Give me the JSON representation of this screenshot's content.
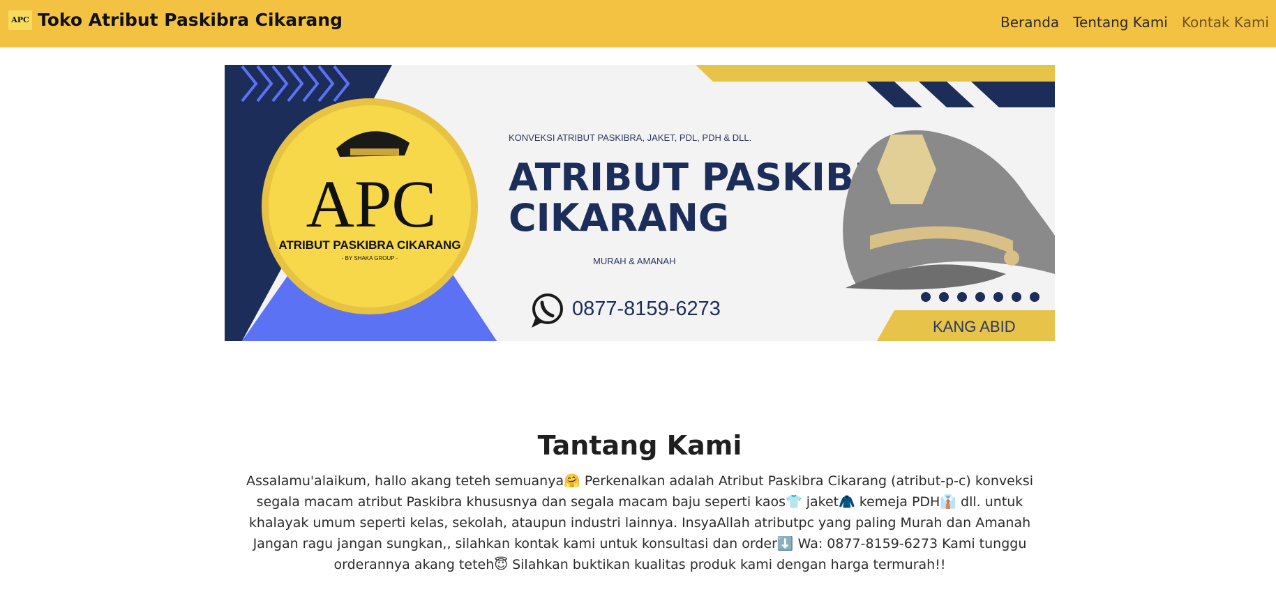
{
  "navbar": {
    "logo_text": "APC",
    "brand_title": "Toko Atribut Paskibra Cikarang",
    "links": [
      "Beranda",
      "Tentang Kami",
      "Kontak Kami"
    ]
  },
  "banner": {
    "logo_letters": "APC",
    "logo_caption": "ATRIBUT PASKIBRA CIKARANG",
    "logo_sub": "- BY SHAKA GROUP -",
    "tagline": "KONVEKSI ATRIBUT PASKIBRA, JAKET, PDL, PDH & DLL.",
    "headline_1": "ATRIBUT PASKIBRA",
    "headline_2": "CIKARANG",
    "motto": "MURAH & AMANAH",
    "phone": "0877-8159-6273",
    "owner": "KANG ABID",
    "colors": {
      "navy": "#1c2d5a",
      "yellow": "#f5d649",
      "blue": "#5c72f5",
      "gold": "#e7c34a"
    }
  },
  "about": {
    "title": "Tantang Kami",
    "body": "Assalamu'alaikum, hallo akang teteh semuanya🤗 Perkenalkan adalah Atribut Paskibra Cikarang (atribut-p-c) konveksi segala macam atribut Paskibra khususnya dan segala macam baju seperti kaos👕 jaket🧥 kemeja PDH👔 dll. untuk khalayak umum seperti kelas, sekolah, ataupun industri lainnya. InsyaAllah atributpc yang paling Murah dan Amanah Jangan ragu jangan sungkan,, silahkan kontak kami untuk konsultasi dan order⬇️ Wa: 0877-8159-6273 Kami tunggu orderannya akang teteh😇 Silahkan buktikan kualitas produk kami dengan harga termurah!!"
  }
}
